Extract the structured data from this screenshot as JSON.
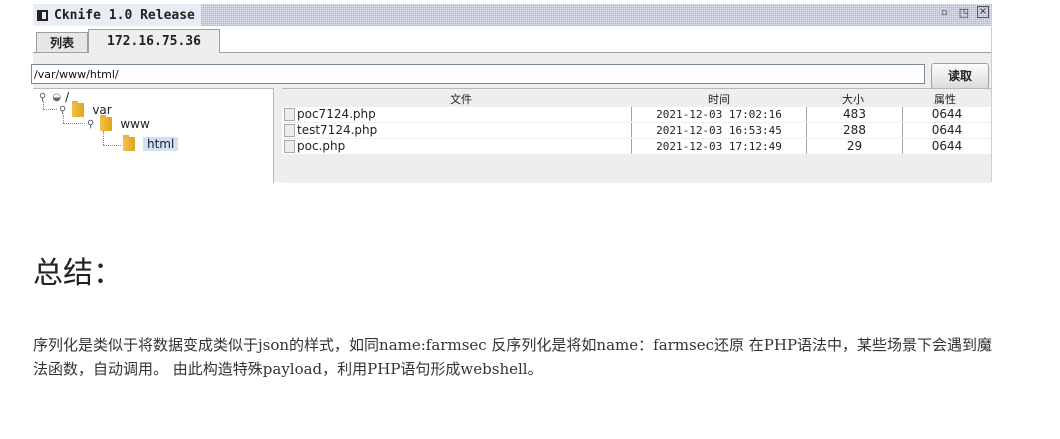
{
  "window": {
    "title": "Cknife 1.0 Release",
    "controls": {
      "restore": "▫",
      "maximize": "◳",
      "close": "⊠"
    }
  },
  "tabs": [
    {
      "label": "列表"
    },
    {
      "label": "172.16.75.36"
    }
  ],
  "path": {
    "value": "/var/www/html/",
    "read_button": "读取"
  },
  "tree": {
    "root": "/",
    "var": "var",
    "www": "www",
    "html": "html"
  },
  "files": {
    "headers": {
      "name": "文件",
      "time": "时间",
      "size": "大小",
      "attr": "属性"
    },
    "rows": [
      {
        "name": "poc7124.php",
        "time": "2021-12-03 17:02:16",
        "size": "483",
        "attr": "0644"
      },
      {
        "name": "test7124.php",
        "time": "2021-12-03 16:53:45",
        "size": "288",
        "attr": "0644"
      },
      {
        "name": "poc.php",
        "time": "2021-12-03 17:12:49",
        "size": "29",
        "attr": "0644"
      }
    ]
  },
  "article": {
    "heading": "总结：",
    "paragraph": "序列化是类似于将数据变成类似于json的样式，如同name:farmsec 反序列化是将如name：farmsec还原 在PHP语法中，某些场景下会遇到魔法函数，自动调用。 由此构造特殊payload，利用PHP语句形成webshell。"
  }
}
